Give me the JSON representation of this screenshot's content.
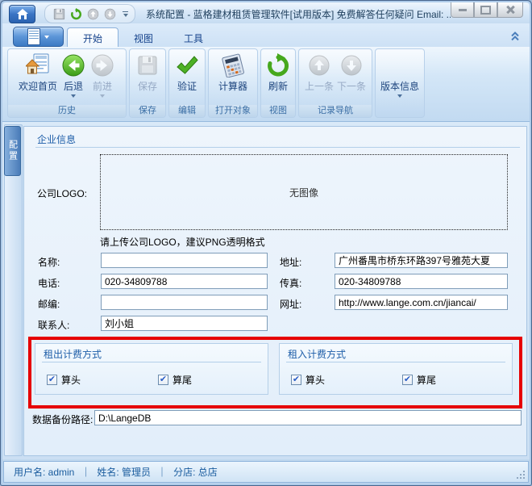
{
  "titlebar": {
    "title": "系统配置 - 蓝格建材租赁管理软件[试用版本] 免费解答任何疑问 Email: ..."
  },
  "tabs": {
    "items": [
      {
        "label": "开始",
        "active": true
      },
      {
        "label": "视图",
        "active": false
      },
      {
        "label": "工具",
        "active": false
      }
    ]
  },
  "ribbon": {
    "groups": [
      {
        "caption": "历史",
        "buttons": [
          {
            "label": "欢迎首页",
            "icon": "welcome-home",
            "disabled": false,
            "dropdown": false
          },
          {
            "label": "后退",
            "icon": "back-arrow",
            "disabled": false,
            "dropdown": true
          },
          {
            "label": "前进",
            "icon": "forward-arrow",
            "disabled": true,
            "dropdown": true
          }
        ]
      },
      {
        "caption": "保存",
        "buttons": [
          {
            "label": "保存",
            "icon": "save-floppy",
            "disabled": true,
            "dropdown": false
          }
        ]
      },
      {
        "caption": "编辑",
        "buttons": [
          {
            "label": "验证",
            "icon": "green-check",
            "disabled": false,
            "dropdown": false
          }
        ]
      },
      {
        "caption": "打开对象",
        "buttons": [
          {
            "label": "计算器",
            "icon": "calculator",
            "disabled": false,
            "dropdown": false
          }
        ]
      },
      {
        "caption": "视图",
        "buttons": [
          {
            "label": "刷新",
            "icon": "refresh",
            "disabled": false,
            "dropdown": false
          }
        ]
      },
      {
        "caption": "记录导航",
        "buttons": [
          {
            "label": "上一条",
            "icon": "up-circle",
            "disabled": true,
            "dropdown": false
          },
          {
            "label": "下一条",
            "icon": "down-circle",
            "disabled": true,
            "dropdown": false
          }
        ]
      },
      {
        "caption": "",
        "buttons": [
          {
            "label": "版本信息",
            "icon": "",
            "disabled": false,
            "dropdown": true
          }
        ]
      }
    ]
  },
  "side_tab": {
    "label": "配置"
  },
  "form": {
    "section_title": "企业信息",
    "logo": {
      "label": "公司LOGO:",
      "placeholder": "无图像",
      "hint": "请上传公司LOGO，建议PNG透明格式"
    },
    "fields": {
      "name": {
        "label": "名称:",
        "value": ""
      },
      "address": {
        "label": "地址:",
        "value": "广州番禺市桥东环路397号雅苑大夏"
      },
      "phone": {
        "label": "电话:",
        "value": "020-34809788"
      },
      "fax": {
        "label": "传真:",
        "value": "020-34809788"
      },
      "zip": {
        "label": "邮编:",
        "value": ""
      },
      "website": {
        "label": "网址:",
        "value": "http://www.lange.com.cn/jiancai/"
      },
      "contact": {
        "label": "联系人:",
        "value": "刘小姐"
      }
    },
    "billing_out": {
      "title": "租出计费方式",
      "checks": [
        {
          "label": "算头",
          "checked": true,
          "mark": "✔"
        },
        {
          "label": "算尾",
          "checked": true,
          "mark": "✔"
        }
      ]
    },
    "billing_in": {
      "title": "租入计费方式",
      "checks": [
        {
          "label": "算头",
          "checked": true,
          "mark": "✔"
        },
        {
          "label": "算尾",
          "checked": true,
          "mark": "✔"
        }
      ]
    },
    "backup": {
      "label": "数据备份路径:",
      "value": "D:\\LangeDB"
    }
  },
  "annotation": {
    "color": "#e60000"
  },
  "statusbar": {
    "items": [
      "用户名: admin",
      "姓名: 管理员",
      "分店: 总店"
    ],
    "separator": "｜"
  }
}
